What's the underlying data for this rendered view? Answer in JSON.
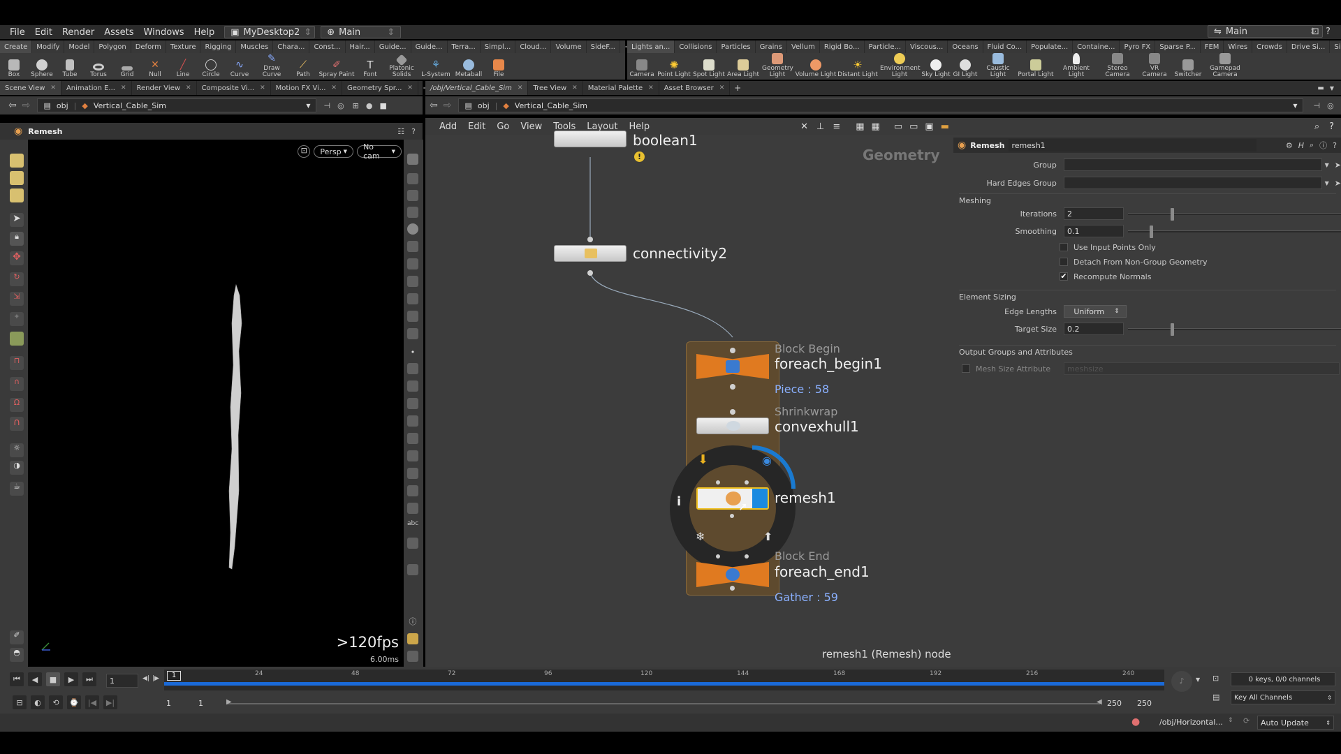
{
  "menubar": {
    "items": [
      "File",
      "Edit",
      "Render",
      "Assets",
      "Windows",
      "Help"
    ],
    "desktop": "MyDesktop2",
    "context": "Main",
    "right_context": "Main"
  },
  "shelf_tabs_left": [
    "Create",
    "Modify",
    "Model",
    "Polygon",
    "Deform",
    "Texture",
    "Rigging",
    "Muscles",
    "Chara...",
    "Const...",
    "Hair...",
    "Guide...",
    "Guide...",
    "Terra...",
    "Simpl...",
    "Cloud...",
    "Volume",
    "SideF..."
  ],
  "shelf_tabs_right": [
    "Lights an...",
    "Collisions",
    "Particles",
    "Grains",
    "Vellum",
    "Rigid Bo...",
    "Particle...",
    "Viscous...",
    "Oceans",
    "Fluid Co...",
    "Populate...",
    "Containe...",
    "Pyro FX",
    "Sparse P...",
    "FEM",
    "Wires",
    "Crowds",
    "Drive Si...",
    "SideFX L..."
  ],
  "shelf_tools_left": [
    "Box",
    "Sphere",
    "Tube",
    "Torus",
    "Grid",
    "Null",
    "Line",
    "Circle",
    "Curve",
    "Draw Curve",
    "Path",
    "Spray Paint",
    "Font",
    "Platonic Solids",
    "L-System",
    "Metaball",
    "File"
  ],
  "shelf_tools_right": [
    "Camera",
    "Point Light",
    "Spot Light",
    "Area Light",
    "Geometry Light",
    "Volume Light",
    "Distant Light",
    "Environment Light",
    "Sky Light",
    "GI Light",
    "Caustic Light",
    "Portal Light",
    "Ambient Light",
    "Stereo Camera",
    "VR Camera",
    "Switcher",
    "Gamepad Camera"
  ],
  "left_pane": {
    "tabs": [
      "Scene View",
      "Animation E...",
      "Render View",
      "Composite Vi...",
      "Motion FX Vi...",
      "Geometry Spr..."
    ],
    "path_root": "obj",
    "path_node": "Vertical_Cable_Sim",
    "tool_title": "Remesh",
    "persp": "Persp",
    "cam": "No cam",
    "fps": ">120fps",
    "ms": "6.00ms"
  },
  "right_pane": {
    "tabs": [
      "/obj/Vertical_Cable_Sim",
      "Tree View",
      "Material Palette",
      "Asset Browser"
    ],
    "path_root": "obj",
    "path_node": "Vertical_Cable_Sim",
    "menu": [
      "Add",
      "Edit",
      "Go",
      "View",
      "Tools",
      "Layout",
      "Help"
    ],
    "context_label": "Geometry",
    "footer": "remesh1 (Remesh) node"
  },
  "nodes": {
    "boolean": "boolean1",
    "connectivity": "connectivity2",
    "begin_type": "Block Begin",
    "begin_name": "foreach_begin1",
    "begin_info": "Piece : 58",
    "hull_type": "Shrinkwrap",
    "hull_name": "convexhull1",
    "remesh_name": "remesh1",
    "end_type": "Block End",
    "end_name": "foreach_end1",
    "end_info": "Gather : 59",
    "ring_info": "i"
  },
  "params": {
    "node_type": "Remesh",
    "node_name": "remesh1",
    "group_label": "Group",
    "hard_edges_label": "Hard Edges Group",
    "meshing_section": "Meshing",
    "iterations_label": "Iterations",
    "iterations_value": "2",
    "iterations_fraction": 0.2,
    "smoothing_label": "Smoothing",
    "smoothing_value": "0.1",
    "smoothing_fraction": 0.1,
    "use_input_points": "Use Input Points Only",
    "detach": "Detach From Non-Group Geometry",
    "recompute": "Recompute Normals",
    "recompute_checked": "✔",
    "element_sizing_section": "Element Sizing",
    "edge_lengths_label": "Edge Lengths",
    "edge_lengths_value": "Uniform",
    "target_size_label": "Target Size",
    "target_size_value": "0.2",
    "target_size_fraction": 0.2,
    "output_section": "Output Groups and Attributes",
    "mesh_size_label": "Mesh Size Attribute",
    "mesh_size_value": "meshsize"
  },
  "timeline": {
    "current_frame": "1",
    "frame_marker": "1",
    "ticks": [
      "24",
      "48",
      "72",
      "96",
      "120",
      "144",
      "168",
      "192",
      "216",
      "240"
    ],
    "range_start": "1",
    "range_start2": "1",
    "range_end": "250",
    "range_end2": "250",
    "keys_info": "0 keys, 0/0 channels",
    "key_all": "Key All Channels"
  },
  "status": {
    "path": "/obj/Horizontal...",
    "update": "Auto Update"
  }
}
